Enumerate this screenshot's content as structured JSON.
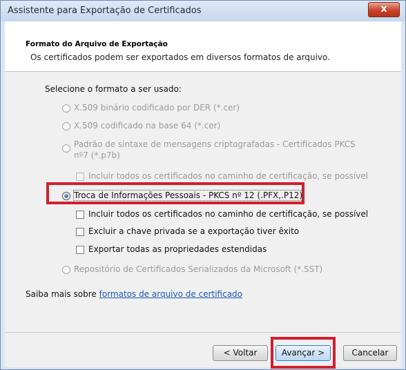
{
  "window": {
    "title": "Assistente para Exportação de Certificados",
    "close_glyph": "x"
  },
  "header": {
    "title": "Formato do Arquivo de Exportação",
    "subtitle": "Os certificados podem ser exportados em diversos formatos de arquivo."
  },
  "form": {
    "prompt": "Selecione o formato a ser usado:",
    "options": [
      {
        "label": "X.509 binário codificado por DER (*.cer)",
        "enabled": false,
        "checked": false
      },
      {
        "label": "X.509 codificado na base 64 (*.cer)",
        "enabled": false,
        "checked": false
      },
      {
        "label_line1": "Padrão de sintaxe de mensagens criptografadas - Certificados PKCS",
        "label_line2": "nº7 (*.p7b)",
        "enabled": false,
        "checked": false
      },
      {
        "label": "Troca de Informações Pessoais - PKCS nº 12 (.PFX,.P12)",
        "enabled": true,
        "checked": true
      },
      {
        "label": "Repositório de Certificados Serializados da Microsoft (*.SST)",
        "enabled": false,
        "checked": false
      }
    ],
    "p7b_sub_checkbox": {
      "label": "Incluir todos os certificados no caminho de certificação, se possível",
      "enabled": false,
      "checked": false
    },
    "pfx_checkboxes": [
      {
        "label": "Incluir todos os certificados no caminho de certificação, se possível",
        "enabled": true,
        "checked": false
      },
      {
        "label": "Excluir a chave privada se a exportação tiver êxito",
        "enabled": true,
        "checked": false
      },
      {
        "label": "Exportar todas as propriedades estendidas",
        "enabled": true,
        "checked": false
      }
    ],
    "learn_more_prefix": "Saiba mais sobre ",
    "learn_more_link": "formatos de arquivo de certificado"
  },
  "footer": {
    "back_label": "< Voltar",
    "next_label": "Avançar >",
    "cancel_label": "Cancelar"
  },
  "highlight_color": "#d11f2d"
}
